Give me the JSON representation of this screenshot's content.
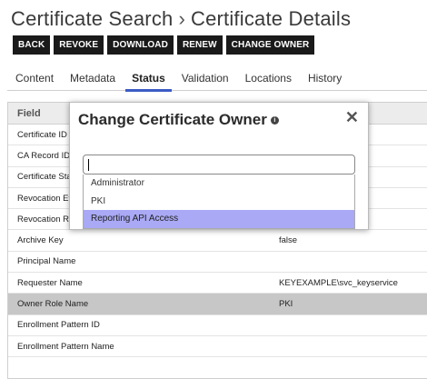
{
  "header": {
    "breadcrumb_root": "Certificate Search",
    "separator": "›",
    "breadcrumb_current": "Certificate Details"
  },
  "toolbar": {
    "buttons": [
      "BACK",
      "REVOKE",
      "DOWNLOAD",
      "RENEW",
      "CHANGE OWNER"
    ]
  },
  "tabs": {
    "items": [
      "Content",
      "Metadata",
      "Status",
      "Validation",
      "Locations",
      "History"
    ],
    "active": "Status"
  },
  "grid": {
    "column_header": "Field",
    "rows": [
      {
        "field": "Certificate ID",
        "value": ""
      },
      {
        "field": "CA Record ID",
        "value": ""
      },
      {
        "field": "Certificate State",
        "value": ""
      },
      {
        "field": "Revocation Effective Date",
        "value": ""
      },
      {
        "field": "Revocation Reason",
        "value": ""
      },
      {
        "field": "Archive Key",
        "value": "false"
      },
      {
        "field": "Principal Name",
        "value": ""
      },
      {
        "field": "Requester Name",
        "value": "KEYEXAMPLE\\svc_keyservice"
      },
      {
        "field": "Owner Role Name",
        "value": "PKI"
      },
      {
        "field": "Enrollment Pattern ID",
        "value": ""
      },
      {
        "field": "Enrollment Pattern Name",
        "value": ""
      }
    ],
    "selected_row": "Owner Role Name"
  },
  "modal": {
    "title": "Change Certificate Owner",
    "info_icon": "info-icon",
    "close_icon": "close-icon",
    "close_glyph": "✕",
    "search_value": "",
    "options": [
      "Administrator",
      "PKI",
      "Reporting API Access"
    ],
    "highlighted_option": "Reporting API Access"
  },
  "colors": {
    "toolbar_bg": "#1a1a1a",
    "tab_underline": "#3b5bc4",
    "selected_row": "#c7c7c7",
    "highlighted_option": "#a9a9f5"
  }
}
